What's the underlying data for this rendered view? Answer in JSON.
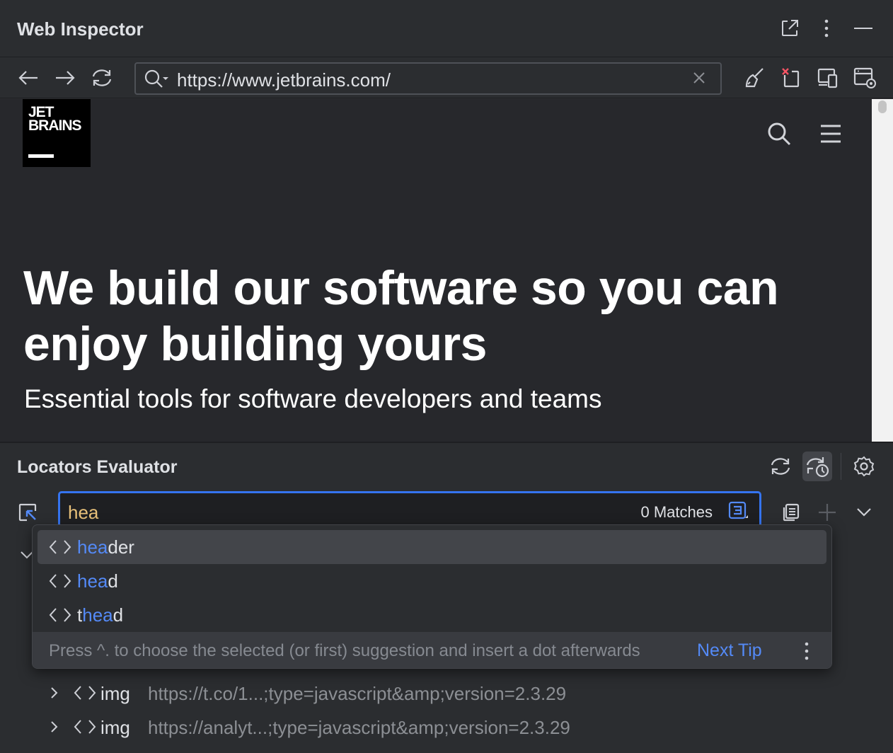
{
  "window": {
    "title": "Web Inspector",
    "icons": [
      "open-in-window-icon",
      "more-vertical-icon",
      "minimize-icon"
    ]
  },
  "navbar": {
    "url": "https://www.jetbrains.com/",
    "icons": [
      "back-icon",
      "forward-icon",
      "reload-icon",
      "search-history-icon",
      "clear-icon",
      "clear-cache-icon",
      "close-tab-icon",
      "device-mode-icon",
      "settings-window-icon"
    ]
  },
  "webview": {
    "logo": {
      "line1": "JET",
      "line2": "BRAINS"
    },
    "headline": "We build our software so you can enjoy building yours",
    "subheadline": "Essential tools for software developers and teams"
  },
  "locators": {
    "title": "Locators Evaluator",
    "input_value": "hea",
    "matches": "0 Matches",
    "suggestions": [
      {
        "highlight": "hea",
        "rest_before": "",
        "rest_after": "der",
        "selected": true
      },
      {
        "highlight": "hea",
        "rest_before": "",
        "rest_after": "d",
        "selected": false
      },
      {
        "highlight": "hea",
        "rest_before": "t",
        "rest_after": "d",
        "selected": false
      }
    ],
    "tip": "Press ^. to choose the selected (or first) suggestion and insert a dot afterwards",
    "next_tip": "Next Tip",
    "tree": [
      {
        "tag": "img",
        "src": "https://t.co/1...;type=javascript&amp;version=2.3.29"
      },
      {
        "tag": "img",
        "src": "https://analyt...;type=javascript&amp;version=2.3.29"
      }
    ]
  },
  "colors": {
    "accent": "#3574f0",
    "highlight": "#548af7",
    "input_value": "#e8c17a",
    "background": "#2b2d30"
  }
}
